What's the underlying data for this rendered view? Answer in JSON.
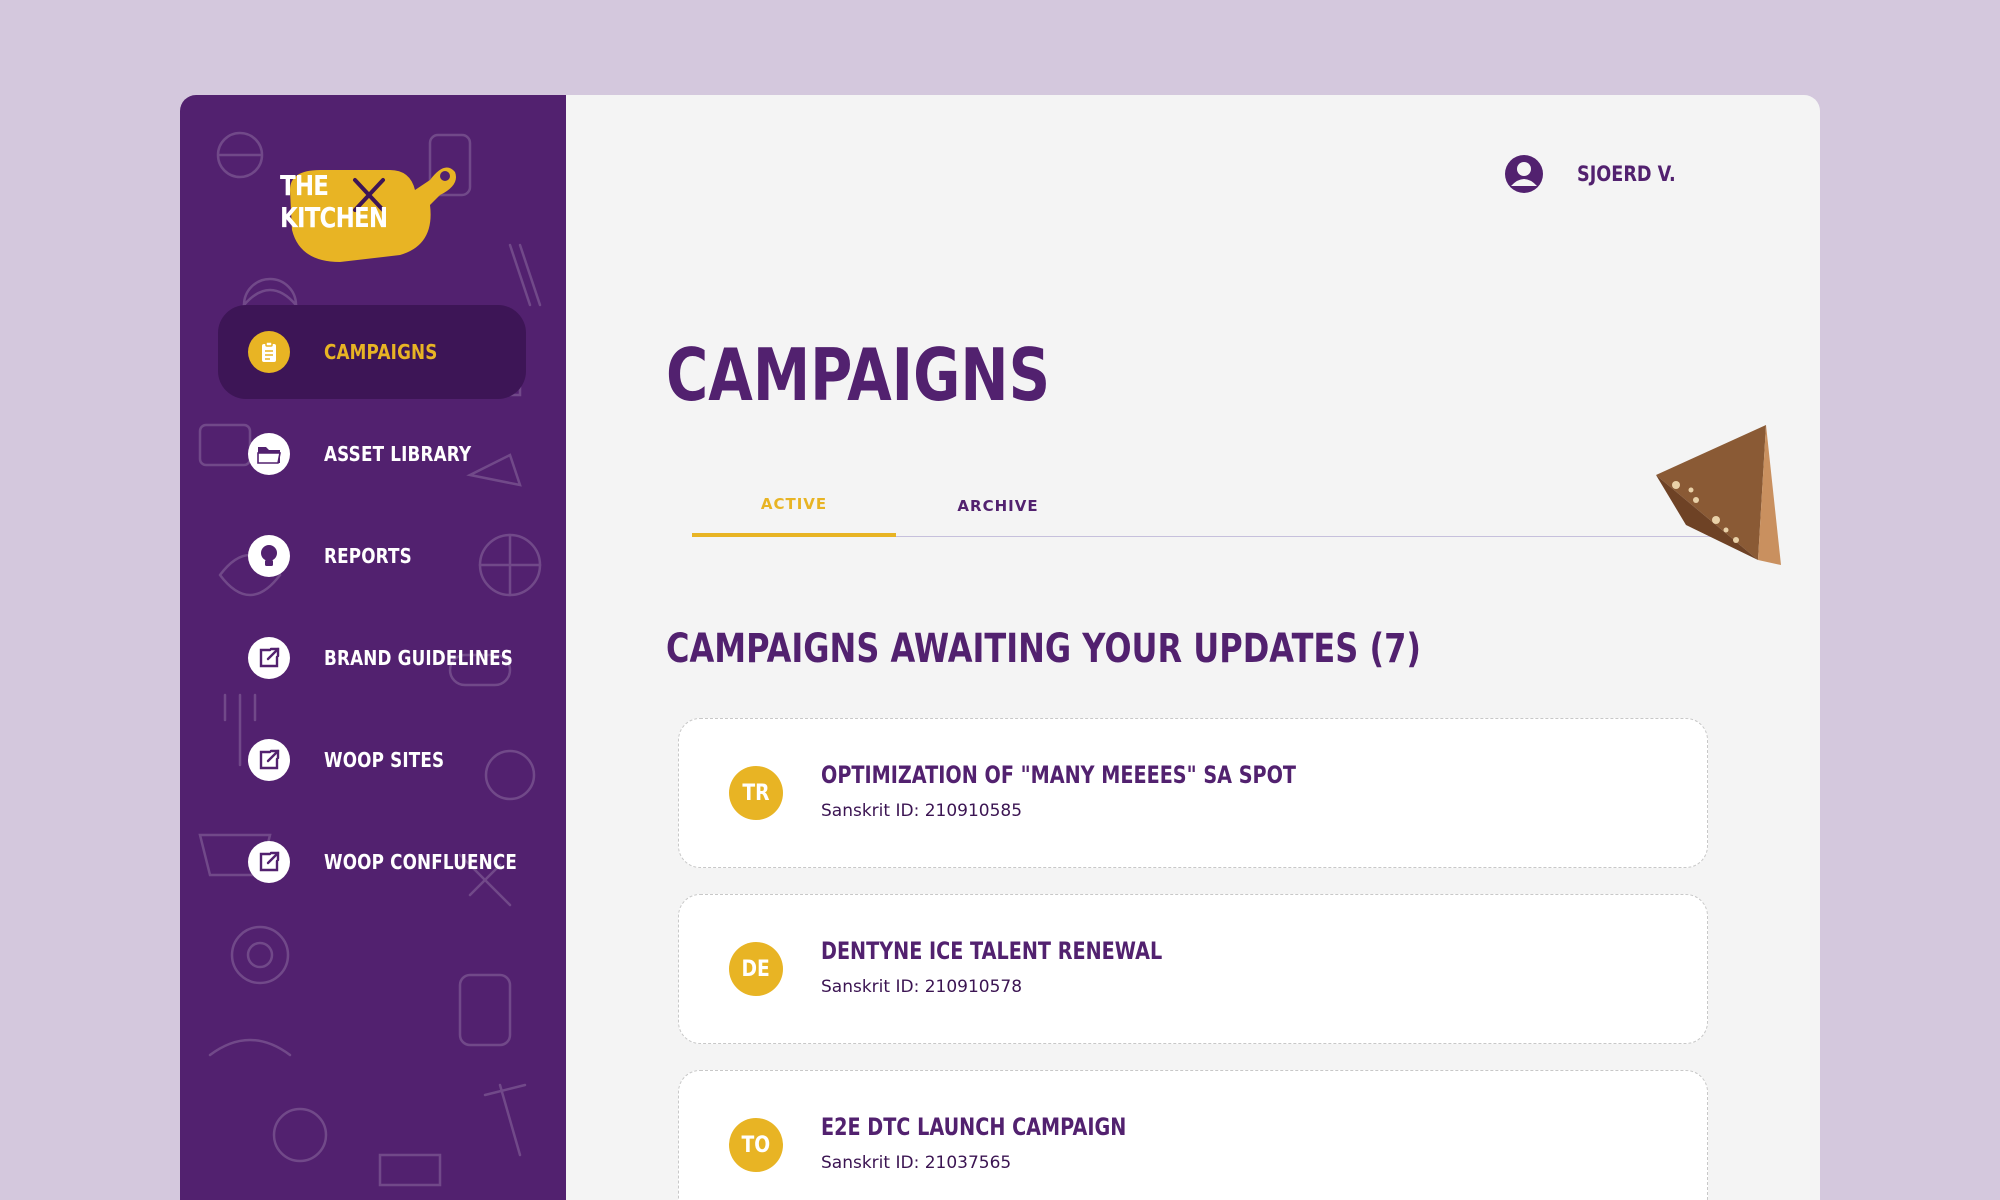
{
  "colors": {
    "page_bg": "#d4c8dd",
    "sidebar_bg": "#52216f",
    "sidebar_active_bg": "#3d1556",
    "accent_yellow": "#e8b424",
    "brand_purple": "#52216f",
    "content_bg": "#f4f4f4"
  },
  "logo": {
    "line1": "THE",
    "line2": "KITCHEN",
    "icon": "fork-knife-cutting-board-logo"
  },
  "sidebar": {
    "items": [
      {
        "label": "CAMPAIGNS",
        "icon": "clipboard-icon",
        "active": true
      },
      {
        "label": "ASSET LIBRARY",
        "icon": "folder-icon",
        "active": false
      },
      {
        "label": "REPORTS",
        "icon": "lightbulb-icon",
        "active": false
      },
      {
        "label": "BRAND GUIDELINES",
        "icon": "external-link-icon",
        "active": false
      },
      {
        "label": "WOOP SITES",
        "icon": "external-link-icon",
        "active": false
      },
      {
        "label": "WOOP CONFLUENCE",
        "icon": "external-link-icon",
        "active": false
      }
    ]
  },
  "header": {
    "user_name": "SJOERD V.",
    "user_icon": "user-account-icon"
  },
  "main": {
    "title": "CAMPAIGNS",
    "tabs": [
      {
        "label": "ACTIVE",
        "active": true
      },
      {
        "label": "ARCHIVE",
        "active": false
      }
    ],
    "section_title": "CAMPAIGNS AWAITING YOUR UPDATES (7)",
    "campaigns": [
      {
        "initials": "TR",
        "title": "OPTIMIZATION OF \"MANY MEEEES\" SA SPOT",
        "subtitle": "Sanskrit ID: 210910585"
      },
      {
        "initials": "DE",
        "title": "DENTYNE ICE TALENT RENEWAL",
        "subtitle": "Sanskrit ID: 210910578"
      },
      {
        "initials": "TO",
        "title": "E2E DTC LAUNCH CAMPAIGN",
        "subtitle": "Sanskrit ID: 21037565"
      }
    ]
  }
}
